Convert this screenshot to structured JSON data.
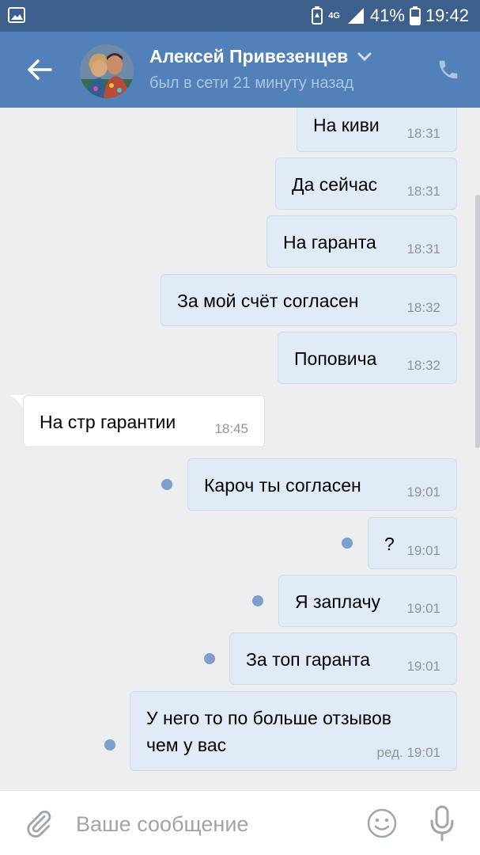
{
  "status_bar": {
    "network": "4G",
    "battery": "41%",
    "time": "19:42",
    "icons": [
      "image-icon",
      "battery-saver-icon",
      "signal-icon",
      "battery-icon"
    ]
  },
  "header": {
    "contact_name": "Алексей Привезенцев",
    "contact_status": "был в сети 21 минуту назад",
    "icons": [
      "back-arrow-icon",
      "chevron-down-icon",
      "phone-icon"
    ]
  },
  "messages": [
    {
      "direction": "out",
      "text": "На киви",
      "time": "18:31",
      "unread": false
    },
    {
      "direction": "out",
      "text": "Да сейчас",
      "time": "18:31",
      "unread": false
    },
    {
      "direction": "out",
      "text": "На гаранта",
      "time": "18:31",
      "unread": false
    },
    {
      "direction": "out",
      "text": "За мой счёт согласен",
      "time": "18:32",
      "unread": false
    },
    {
      "direction": "out",
      "text": "Поповича",
      "time": "18:32",
      "unread": false
    },
    {
      "direction": "in",
      "text": "На стр гарантии",
      "time": "18:45",
      "unread": false
    },
    {
      "direction": "out",
      "text": "Кароч ты согласен",
      "time": "19:01",
      "unread": true
    },
    {
      "direction": "out",
      "text": "?",
      "time": "19:01",
      "unread": true
    },
    {
      "direction": "out",
      "text": "Я заплачу",
      "time": "19:01",
      "unread": true
    },
    {
      "direction": "out",
      "text": "За топ гаранта",
      "time": "19:01",
      "unread": true
    },
    {
      "direction": "out",
      "text_line1": "У него то по больше отзывов",
      "text_line2": "чем у вас",
      "time": "ред. 19:01",
      "unread": true
    }
  ],
  "composer": {
    "placeholder": "Ваше сообщение",
    "icons": [
      "paperclip-icon",
      "emoji-icon",
      "microphone-icon"
    ]
  },
  "colors": {
    "header": "#5181b8",
    "status_bar": "#3d5f8c",
    "outgoing_bubble": "#e1ebf7",
    "incoming_bubble": "#ffffff",
    "unread_dot": "#7d9fca"
  }
}
